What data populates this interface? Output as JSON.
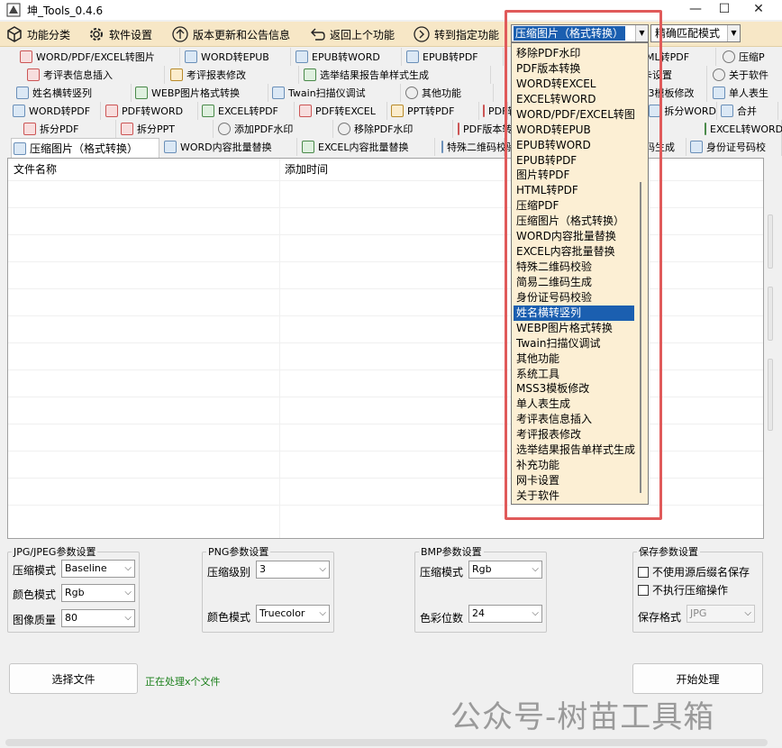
{
  "window": {
    "title": "坤_Tools_0.4.6",
    "controls": [
      "—",
      "☐",
      "✕"
    ]
  },
  "toolbar": {
    "function_category": "功能分类",
    "software_settings": "软件设置",
    "updates_notice": "版本更新和公告信息",
    "back": "返回上个功能",
    "goto_function": "转到指定功能",
    "selected_function": "压缩图片（格式转换）",
    "match_mode": "精确匹配模式"
  },
  "tabs": {
    "row1": [
      "WORD/PDF/EXCEL转图片",
      "WORD转EPUB",
      "EPUB转WORD",
      "EPUB转PDF",
      "HTML转PDF",
      "压缩P"
    ],
    "row2": [
      "考评表信息插入",
      "考评报表修改",
      "选举结果报告单样式生成",
      "网卡设置",
      "关于软件"
    ],
    "row3": [
      "姓名横转竖列",
      "WEBP图片格式转换",
      "Twain扫描仪调试",
      "其他功能",
      "MSS3模板修改",
      "单人表生"
    ],
    "row4": [
      "WORD转PDF",
      "PDF转WORD",
      "EXCEL转PDF",
      "PDF转EXCEL",
      "PPT转PDF",
      "PDF转PPT",
      "拆分WORD",
      "合并",
      "EXCEL转WO"
    ],
    "row5": [
      "拆分PDF",
      "拆分PPT",
      "添加PDF水印",
      "移除PDF水印",
      "PDF版本转换",
      "EXCEL转WORD"
    ],
    "row6": [
      "压缩图片（格式转换）",
      "WORD内容批量替换",
      "EXCEL内容批量替换",
      "特殊二维码校验",
      "简易二维码生成",
      "身份证号码校"
    ]
  },
  "file_list": {
    "col_name": "文件名称",
    "col_time": "添加时间"
  },
  "jpg_group": {
    "title": "JPG/JPEG参数设置",
    "compress_mode_label": "压缩模式",
    "compress_mode_value": "Baseline",
    "color_mode_label": "颜色模式",
    "color_mode_value": "Rgb",
    "quality_label": "图像质量",
    "quality_value": "80"
  },
  "png_group": {
    "title": "PNG参数设置",
    "level_label": "压缩级别",
    "level_value": "3",
    "color_mode_label": "颜色模式",
    "color_mode_value": "Truecolor"
  },
  "bmp_group": {
    "title": "BMP参数设置",
    "compress_mode_label": "压缩模式",
    "compress_mode_value": "Rgb",
    "bit_depth_label": "色彩位数",
    "bit_depth_value": "24"
  },
  "save_group": {
    "title": "保存参数设置",
    "no_suffix": "不使用源后缀名保存",
    "no_compress": "不执行压缩操作",
    "format_label": "保存格式",
    "format_value": "JPG"
  },
  "actions": {
    "select_file": "选择文件",
    "status": "正在处理x个文件",
    "start": "开始处理"
  },
  "watermark": "公众号-树苗工具箱",
  "dropdown": {
    "items": [
      "移除PDF水印",
      "PDF版本转换",
      "WORD转EXCEL",
      "EXCEL转WORD",
      "WORD/PDF/EXCEL转图",
      "WORD转EPUB",
      "EPUB转WORD",
      "EPUB转PDF",
      "图片转PDF",
      "HTML转PDF",
      "压缩PDF",
      "压缩图片（格式转换）",
      "WORD内容批量替换",
      "EXCEL内容批量替换",
      "特殊二维码校验",
      "简易二维码生成",
      "身份证号码校验",
      "姓名横转竖列",
      "WEBP图片格式转换",
      "Twain扫描仪调试",
      "其他功能",
      "系统工具",
      "MSS3模板修改",
      "单人表生成",
      "考评表信息插入",
      "考评报表修改",
      "选举结果报告单样式生成",
      "补充功能",
      "网卡设置",
      "关于软件"
    ],
    "selected_index": 17
  },
  "colors": {
    "toolbar_bg": "#f7e7c6",
    "dropdown_bg": "#fcefd4",
    "selection": "#1b5fb0",
    "highlight": "#e05a5a",
    "status_green": "#1a7f1a"
  }
}
